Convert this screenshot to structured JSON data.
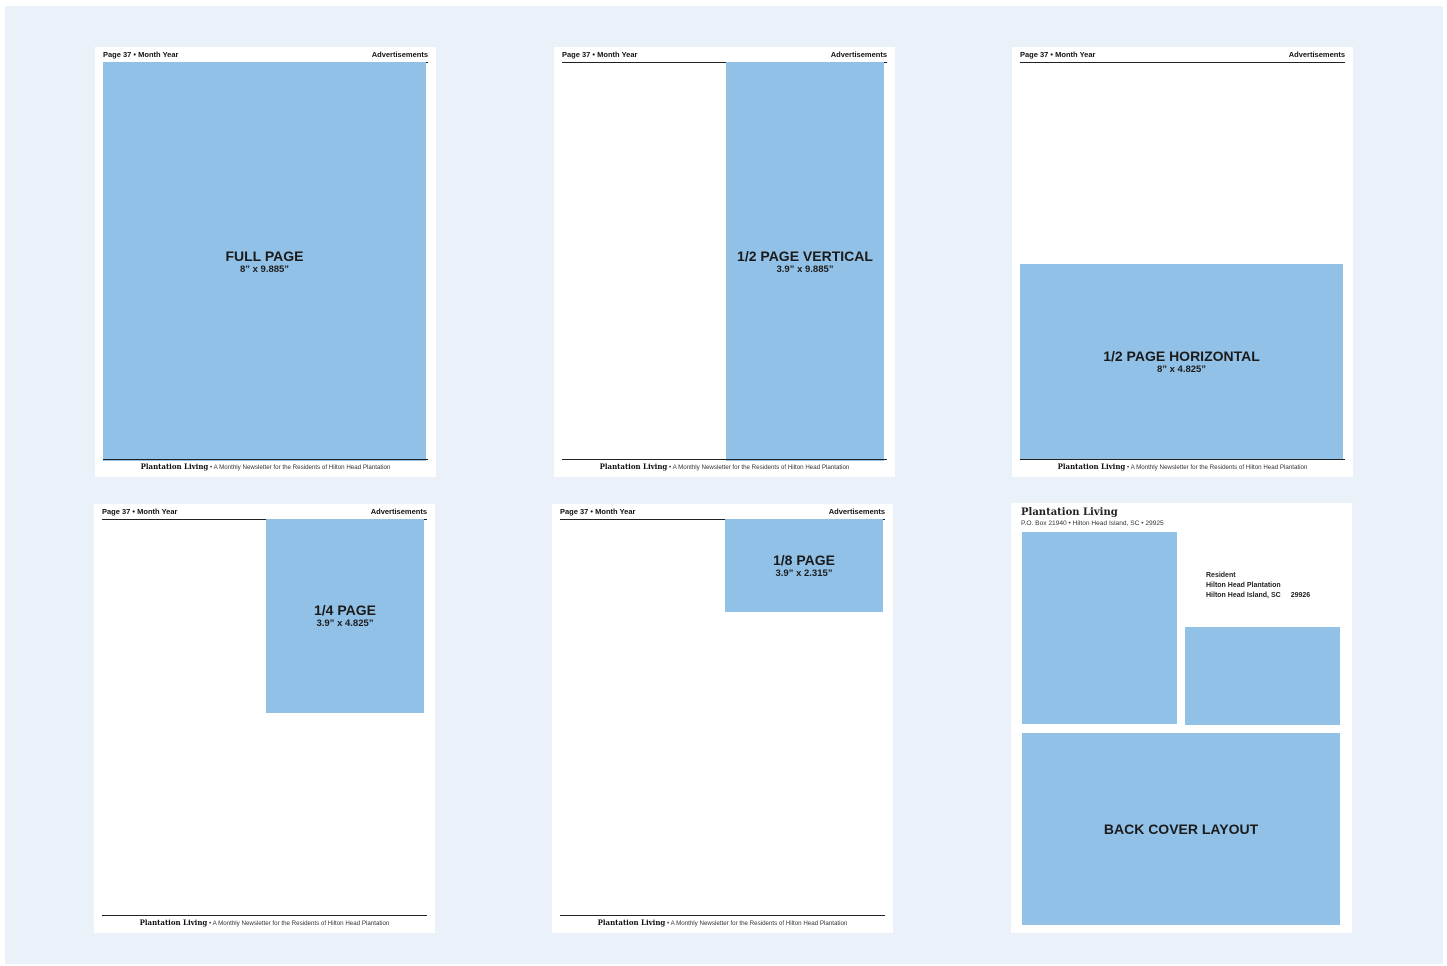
{
  "header": {
    "page_label": "Page 37 • Month Year",
    "section": "Advertisements"
  },
  "footer": {
    "brand": "Plantation Living",
    "tagline": " • A Monthly Newsletter for the Residents of Hilton Head Plantation"
  },
  "ads": {
    "full": {
      "title": "FULL PAGE",
      "size": "8” x 9.885”"
    },
    "half_vertical": {
      "title": "1/2 PAGE VERTICAL",
      "size": "3.9” x 9.885”"
    },
    "half_horizontal": {
      "title": "1/2 PAGE HORIZONTAL",
      "size": "8” x 4.825”"
    },
    "quarter": {
      "title": "1/4 PAGE",
      "size": "3.9” x 4.825”"
    },
    "eighth": {
      "title": "1/8 PAGE",
      "size": "3.9” x 2.315”"
    },
    "back_cover": {
      "title": "BACK COVER LAYOUT"
    }
  },
  "back_cover": {
    "masthead": "Plantation Living",
    "return_address": "P.O. Box 21940 • Hilton Head Island, SC • 29925",
    "mailing": {
      "line1": "Resident",
      "line2": "Hilton Head Plantation",
      "line3": "Hilton Head Island, SC",
      "zip": "29926"
    }
  },
  "colors": {
    "ad_fill": "#92c1e7",
    "background": "#eaf1f9"
  }
}
